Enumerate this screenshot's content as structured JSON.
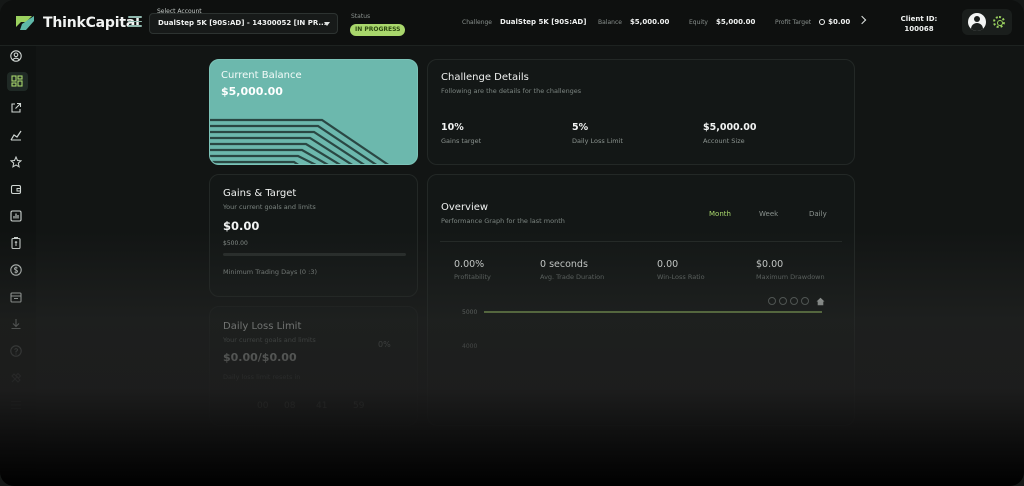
{
  "brand": {
    "name": "ThinkCapital"
  },
  "header": {
    "account_label": "Select Account",
    "account_value": "DualStep 5K [90S:AD] - 14300052 [IN PR...",
    "status_label": "Status",
    "status_value": "IN PROGRESS",
    "challenge_label": "Challenge",
    "challenge_value": "DualStep 5K [90S:AD]",
    "balance_label": "Balance",
    "balance_value": "$5,000.00",
    "equity_label": "Equity",
    "equity_value": "$5,000.00",
    "profit_label": "Profit Target",
    "profit_value": "$0.00",
    "client_label": "Client ID:",
    "client_value": "100068"
  },
  "sidebar": {
    "icons": [
      "user-icon",
      "dashboard-icon",
      "external-link-icon",
      "chart-trend-icon",
      "star-icon",
      "wallet-icon",
      "bar-chart-icon",
      "certificate-icon",
      "dollar-icon",
      "calendar-icon",
      "download-icon",
      "help-icon",
      "tools-icon",
      "list-icon"
    ]
  },
  "balance_card": {
    "title": "Current Balance",
    "value": "$5,000.00"
  },
  "details_card": {
    "title": "Challenge Details",
    "subtitle": "Following are the details for the challenges",
    "items": [
      {
        "value": "10%",
        "label": "Gains target"
      },
      {
        "value": "5%",
        "label": "Daily Loss Limit"
      },
      {
        "value": "$5,000.00",
        "label": "Account Size"
      }
    ]
  },
  "gains_card": {
    "title": "Gains & Target",
    "subtitle": "Your current goals and limits",
    "value": "$0.00",
    "target": "$500.00",
    "progress": 0,
    "min_days": "Minimum Trading Days (0 :3)"
  },
  "daily_card": {
    "title": "Daily Loss Limit",
    "subtitle": "Your current goals and limits",
    "percent": "0%",
    "value": "$0.00/$0.00",
    "note": "Daily loss limit resets in",
    "timer": [
      "00",
      "08",
      "41",
      "59"
    ]
  },
  "overview_card": {
    "title": "Overview",
    "subtitle": "Performance Graph for the last month",
    "tabs": [
      "Month",
      "Week",
      "Daily"
    ],
    "active_tab": "Month",
    "stats": [
      {
        "value": "0.00%",
        "label": "Profitability"
      },
      {
        "value": "0 seconds",
        "label": "Avg. Trade Duration"
      },
      {
        "value": "0.00",
        "label": "Win-Loss Ratio"
      },
      {
        "value": "$0.00",
        "label": "Maximum Drawdown"
      }
    ]
  },
  "chart_data": {
    "type": "line",
    "y_ticks": [
      "5000",
      "4000"
    ],
    "series": [
      {
        "values": [
          5000,
          5000
        ]
      }
    ],
    "line_color": "#a9d76c"
  }
}
